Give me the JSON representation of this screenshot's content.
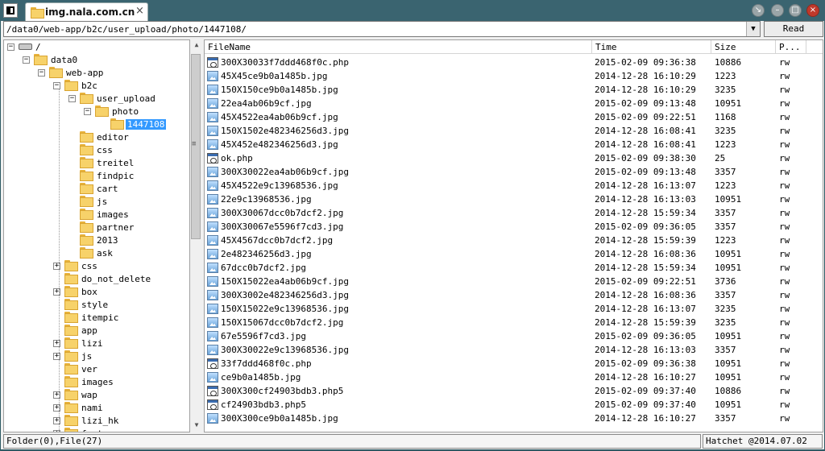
{
  "window": {
    "tab_title": "img.nala.com.cn",
    "tab_close": "×",
    "controls": {
      "restore": "↘",
      "minimize": "–",
      "maximize": "□",
      "close": "×"
    }
  },
  "toolbar": {
    "path": "/data0/web-app/b2c/user_upload/photo/1447108/",
    "dropdown": "▼",
    "read_label": "Read"
  },
  "tree": {
    "nodes": [
      {
        "label": "/",
        "icon": "drive-icon",
        "expander": "−"
      },
      {
        "label": "data0",
        "icon": "folder-icon",
        "expander": "−"
      },
      {
        "label": "web-app",
        "icon": "folder-icon",
        "expander": "−"
      },
      {
        "label": "b2c",
        "icon": "folder-icon",
        "expander": "−"
      },
      {
        "label": "user_upload",
        "icon": "folder-icon",
        "expander": "−"
      },
      {
        "label": "photo",
        "icon": "folder-icon",
        "expander": "−"
      },
      {
        "label": "1447108",
        "icon": "folder-icon",
        "expander": "",
        "selected": true
      },
      {
        "label": "editor",
        "icon": "folder-icon",
        "expander": ""
      },
      {
        "label": "css",
        "icon": "folder-icon",
        "expander": ""
      },
      {
        "label": "treitel",
        "icon": "folder-icon",
        "expander": ""
      },
      {
        "label": "findpic",
        "icon": "folder-icon",
        "expander": ""
      },
      {
        "label": "cart",
        "icon": "folder-icon",
        "expander": ""
      },
      {
        "label": "js",
        "icon": "folder-icon",
        "expander": ""
      },
      {
        "label": "images",
        "icon": "folder-icon",
        "expander": ""
      },
      {
        "label": "partner",
        "icon": "folder-icon",
        "expander": ""
      },
      {
        "label": "2013",
        "icon": "folder-icon",
        "expander": ""
      },
      {
        "label": "ask",
        "icon": "folder-icon",
        "expander": ""
      },
      {
        "label": "css",
        "icon": "folder-icon",
        "expander": "+"
      },
      {
        "label": "do_not_delete",
        "icon": "folder-icon",
        "expander": ""
      },
      {
        "label": "box",
        "icon": "folder-icon",
        "expander": "+"
      },
      {
        "label": "style",
        "icon": "folder-icon",
        "expander": ""
      },
      {
        "label": "itempic",
        "icon": "folder-icon",
        "expander": ""
      },
      {
        "label": "app",
        "icon": "folder-icon",
        "expander": ""
      },
      {
        "label": "lizi",
        "icon": "folder-icon",
        "expander": "+"
      },
      {
        "label": "js",
        "icon": "folder-icon",
        "expander": "+"
      },
      {
        "label": "ver",
        "icon": "folder-icon",
        "expander": ""
      },
      {
        "label": "images",
        "icon": "folder-icon",
        "expander": ""
      },
      {
        "label": "wap",
        "icon": "folder-icon",
        "expander": "+"
      },
      {
        "label": "nami",
        "icon": "folder-icon",
        "expander": "+"
      },
      {
        "label": "lizi_hk",
        "icon": "folder-icon",
        "expander": "+"
      },
      {
        "label": "font",
        "icon": "folder-icon",
        "expander": "+"
      }
    ]
  },
  "list": {
    "columns": [
      "FileName",
      "Time",
      "Size",
      "P..."
    ],
    "rows": [
      {
        "name": "300X30033f7ddd468f0c.php",
        "time": "2015-02-09 09:36:38",
        "size": "10886",
        "perm": "rw",
        "icon": "php-file-icon"
      },
      {
        "name": "45X45ce9b0a1485b.jpg",
        "time": "2014-12-28 16:10:29",
        "size": "1223",
        "perm": "rw",
        "icon": "image-file-icon"
      },
      {
        "name": "150X150ce9b0a1485b.jpg",
        "time": "2014-12-28 16:10:29",
        "size": "3235",
        "perm": "rw",
        "icon": "image-file-icon"
      },
      {
        "name": "22ea4ab06b9cf.jpg",
        "time": "2015-02-09 09:13:48",
        "size": "10951",
        "perm": "rw",
        "icon": "image-file-icon"
      },
      {
        "name": "45X4522ea4ab06b9cf.jpg",
        "time": "2015-02-09 09:22:51",
        "size": "1168",
        "perm": "rw",
        "icon": "image-file-icon"
      },
      {
        "name": "150X1502e482346256d3.jpg",
        "time": "2014-12-28 16:08:41",
        "size": "3235",
        "perm": "rw",
        "icon": "image-file-icon"
      },
      {
        "name": "45X452e482346256d3.jpg",
        "time": "2014-12-28 16:08:41",
        "size": "1223",
        "perm": "rw",
        "icon": "image-file-icon"
      },
      {
        "name": "ok.php",
        "time": "2015-02-09 09:38:30",
        "size": "25",
        "perm": "rw",
        "icon": "php-file-icon"
      },
      {
        "name": "300X30022ea4ab06b9cf.jpg",
        "time": "2015-02-09 09:13:48",
        "size": "3357",
        "perm": "rw",
        "icon": "image-file-icon"
      },
      {
        "name": "45X4522e9c13968536.jpg",
        "time": "2014-12-28 16:13:07",
        "size": "1223",
        "perm": "rw",
        "icon": "image-file-icon"
      },
      {
        "name": "22e9c13968536.jpg",
        "time": "2014-12-28 16:13:03",
        "size": "10951",
        "perm": "rw",
        "icon": "image-file-icon"
      },
      {
        "name": "300X30067dcc0b7dcf2.jpg",
        "time": "2014-12-28 15:59:34",
        "size": "3357",
        "perm": "rw",
        "icon": "image-file-icon"
      },
      {
        "name": "300X30067e5596f7cd3.jpg",
        "time": "2015-02-09 09:36:05",
        "size": "3357",
        "perm": "rw",
        "icon": "image-file-icon"
      },
      {
        "name": "45X4567dcc0b7dcf2.jpg",
        "time": "2014-12-28 15:59:39",
        "size": "1223",
        "perm": "rw",
        "icon": "image-file-icon"
      },
      {
        "name": "2e482346256d3.jpg",
        "time": "2014-12-28 16:08:36",
        "size": "10951",
        "perm": "rw",
        "icon": "image-file-icon"
      },
      {
        "name": "67dcc0b7dcf2.jpg",
        "time": "2014-12-28 15:59:34",
        "size": "10951",
        "perm": "rw",
        "icon": "image-file-icon"
      },
      {
        "name": "150X15022ea4ab06b9cf.jpg",
        "time": "2015-02-09 09:22:51",
        "size": "3736",
        "perm": "rw",
        "icon": "image-file-icon"
      },
      {
        "name": "300X3002e482346256d3.jpg",
        "time": "2014-12-28 16:08:36",
        "size": "3357",
        "perm": "rw",
        "icon": "image-file-icon"
      },
      {
        "name": "150X15022e9c13968536.jpg",
        "time": "2014-12-28 16:13:07",
        "size": "3235",
        "perm": "rw",
        "icon": "image-file-icon"
      },
      {
        "name": "150X15067dcc0b7dcf2.jpg",
        "time": "2014-12-28 15:59:39",
        "size": "3235",
        "perm": "rw",
        "icon": "image-file-icon"
      },
      {
        "name": "67e5596f7cd3.jpg",
        "time": "2015-02-09 09:36:05",
        "size": "10951",
        "perm": "rw",
        "icon": "image-file-icon"
      },
      {
        "name": "300X30022e9c13968536.jpg",
        "time": "2014-12-28 16:13:03",
        "size": "3357",
        "perm": "rw",
        "icon": "image-file-icon"
      },
      {
        "name": "33f7ddd468f0c.php",
        "time": "2015-02-09 09:36:38",
        "size": "10951",
        "perm": "rw",
        "icon": "php-file-icon"
      },
      {
        "name": "ce9b0a1485b.jpg",
        "time": "2014-12-28 16:10:27",
        "size": "10951",
        "perm": "rw",
        "icon": "image-file-icon"
      },
      {
        "name": "300X300cf24903bdb3.php5",
        "time": "2015-02-09 09:37:40",
        "size": "10886",
        "perm": "rw",
        "icon": "php-file-icon"
      },
      {
        "name": "cf24903bdb3.php5",
        "time": "2015-02-09 09:37:40",
        "size": "10951",
        "perm": "rw",
        "icon": "php-file-icon"
      },
      {
        "name": "300X300ce9b0a1485b.jpg",
        "time": "2014-12-28 16:10:27",
        "size": "3357",
        "perm": "rw",
        "icon": "image-file-icon"
      }
    ]
  },
  "status": {
    "left": "Folder(0),File(27)",
    "right": "Hatchet @2014.07.02"
  },
  "colors": {
    "selection": "#3399ff",
    "titlebar": "#3a6470",
    "folder": "#f7d26a"
  }
}
